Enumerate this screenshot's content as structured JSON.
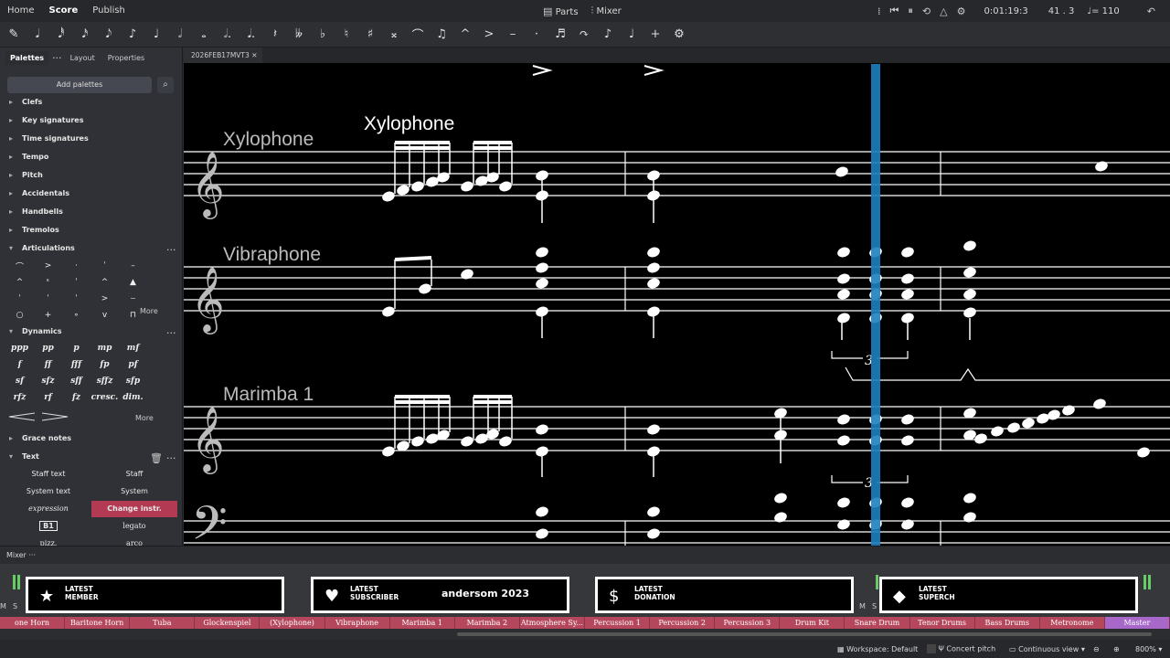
{
  "topbar": {
    "menu": [
      "Home",
      "Score",
      "Publish"
    ],
    "active_menu": "Score",
    "parts": "Parts",
    "mixer": "Mixer",
    "time": "0:01:19:3",
    "position": "41 . 3",
    "tempo": "♩= 110"
  },
  "toolbar": {
    "buttons": [
      "✎",
      "𝅘𝅥",
      "𝅘𝅥𝅰",
      "𝅘𝅥𝅯",
      "𝅘𝅥𝅮",
      "♪",
      "♩",
      "𝅗𝅥",
      "𝅝",
      "𝅗𝅥.",
      "𝅘𝅥.",
      "𝄽",
      "𝄫",
      "♭",
      "♮",
      "♯",
      "𝄪",
      "⌒",
      "♫",
      "^",
      ">",
      "–",
      "·",
      "♬",
      "↷",
      "♪",
      "♩",
      "+",
      "⚙"
    ]
  },
  "palettes": {
    "tabs": [
      "Palettes",
      "Layout",
      "Properties"
    ],
    "add_label": "Add palettes",
    "items": [
      "Clefs",
      "Key signatures",
      "Time signatures",
      "Tempo",
      "Pitch",
      "Accidentals",
      "Handbells",
      "Tremolos"
    ],
    "articulations_title": "Articulations",
    "articulation_symbols": [
      "⌒",
      ">",
      "·",
      "ˈ",
      "–",
      "^",
      "ᵋ",
      "ˈ",
      "^",
      "▲",
      "ˈ",
      "ˈ",
      "ˈ",
      ">",
      "⌣",
      "○",
      "+",
      "∘",
      "v",
      "⊓"
    ],
    "more": "More",
    "dynamics_title": "Dynamics",
    "dynamics": [
      "ppp",
      "pp",
      "p",
      "mp",
      "mf",
      "f",
      "ff",
      "fff",
      "fp",
      "pf",
      "sf",
      "sfz",
      "sff",
      "sffz",
      "sfp",
      "rfz",
      "rf",
      "fz",
      "cresc.",
      "dim."
    ],
    "grace_notes": "Grace notes",
    "text_title": "Text",
    "text_items": {
      "staff_text": "Staff text",
      "staff": "Staff",
      "system_text": "System text",
      "system": "System",
      "expression": "expression",
      "change_instr": "Change instr.",
      "b1": "B1",
      "legato": "legato",
      "pizz": "pizz.",
      "arco": "arco"
    }
  },
  "score": {
    "tab_label": "2026FEB17MVT3",
    "instruments": [
      "Xylophone",
      "Vibraphone",
      "Marimba 1"
    ],
    "overlay_title": "Xylophone",
    "tuplet": "3"
  },
  "mixer": {
    "label": "Mixer",
    "overlays": [
      {
        "icon": "★",
        "line1": "LATEST",
        "line2": "MEMBER",
        "name": ""
      },
      {
        "icon": "♥",
        "line1": "LATEST",
        "line2": "SUBSCRIBER",
        "name": "andersom 2023"
      },
      {
        "icon": "$",
        "line1": "LATEST",
        "line2": "DONATION",
        "name": ""
      },
      {
        "icon": "◆",
        "line1": "LATEST",
        "line2": "SUPERCH",
        "name": ""
      }
    ],
    "channels": [
      "one Horn",
      "Baritone Horn",
      "Tuba",
      "Glockenspiel",
      "(Xylophone)",
      "Vibraphone",
      "Marimba 1",
      "Marimba 2",
      "Atmosphere Sy...",
      "Percussion 1",
      "Percussion 2",
      "Percussion 3",
      "Drum Kit",
      "Snare Drum",
      "Tenor Drums",
      "Bass Drums",
      "Metronome",
      "Master"
    ]
  },
  "status": {
    "workspace": "Workspace: Default",
    "concert_pitch": "Concert pitch",
    "view": "Continuous view",
    "zoom": "800%"
  },
  "colors": {
    "playhead": "#1e7fc0",
    "channel": "#b5475d",
    "master": "#a768c9",
    "change_instr": "#b23a52"
  }
}
